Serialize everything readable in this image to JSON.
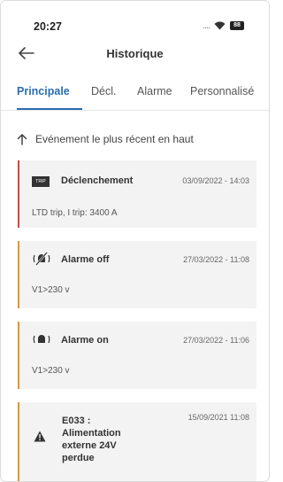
{
  "status_bar": {
    "time": "20:27",
    "dots": "....",
    "battery": "88"
  },
  "header": {
    "title": "Historique"
  },
  "tabs": [
    {
      "label": "Principale",
      "active": true
    },
    {
      "label": "Décl."
    },
    {
      "label": "Alarme"
    },
    {
      "label": "Personnalisé"
    }
  ],
  "sort": {
    "label": "Evénement le plus récent en haut"
  },
  "events": [
    {
      "title": "Déclenchement",
      "date": "03/09/2022 - 14:03",
      "detail": "LTD trip, I trip: 3400 A",
      "icon": "trip-icon",
      "icon_label": "TRIP",
      "color": "#d9463f"
    },
    {
      "title": "Alarme off",
      "date": "27/03/2022 - 11:08",
      "detail": "V1>230 v",
      "icon": "alarm-off-icon",
      "color": "#e0962f"
    },
    {
      "title": "Alarme on",
      "date": "27/03/2022 - 11:06",
      "detail": "V1>230 v",
      "icon": "alarm-on-icon",
      "color": "#e0962f"
    },
    {
      "title": "E033 :\nAlimentation\nexterne 24V\nperdue",
      "date": "15/09/2021  11:08",
      "icon": "warning-icon",
      "color": "#e0962f"
    }
  ]
}
